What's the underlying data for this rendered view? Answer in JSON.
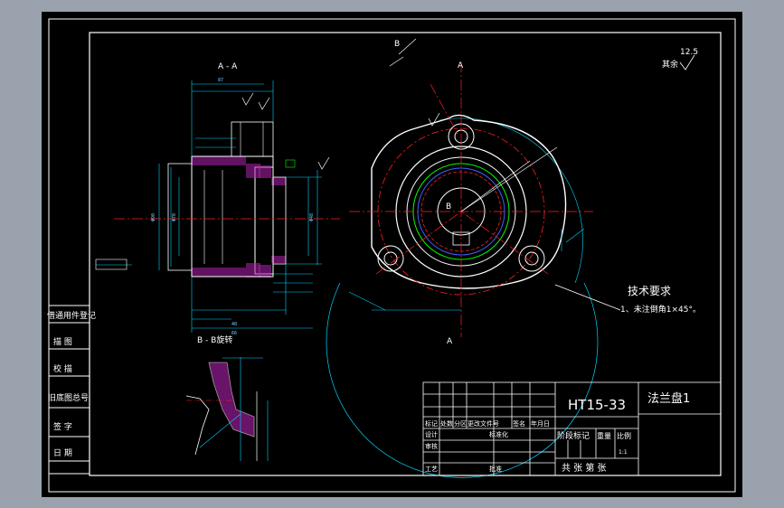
{
  "section_aa": "A - A",
  "section_bb": "B - B旋转",
  "label_a_top": "A",
  "label_a_bottom": "A",
  "label_b": "B",
  "label_b2": "B",
  "remainder_note": "其余",
  "roughness_value": "12.5",
  "tech_title": "技术要求",
  "tech_item1": "1、未注倒角1×45°。",
  "material": "HT15-33",
  "part_name": "法兰盘1",
  "side_table": [
    "借通用件登记",
    "描 图",
    "校 描",
    "旧底图总号",
    "签 字",
    "日 期"
  ],
  "title_block": {
    "row_labels": [
      "标记",
      "处数",
      "分区",
      "更改文件号",
      "签名",
      "年月日"
    ],
    "design": "设计",
    "standardize": "标准化",
    "review": "审核",
    "process": "工艺",
    "approve": "批准",
    "stage_mark": "阶段标记",
    "weight": "重量",
    "scale": "比例",
    "scale_value": "1:1",
    "sheets": "共 张 第 张"
  },
  "colors": {
    "background": "#000000",
    "frame": "#ffffff",
    "dimension": "#00d7ff",
    "center_line": "#ff2020",
    "hatch": "#ff00ff",
    "part_line": "#ffffff",
    "green": "#00ff00"
  }
}
